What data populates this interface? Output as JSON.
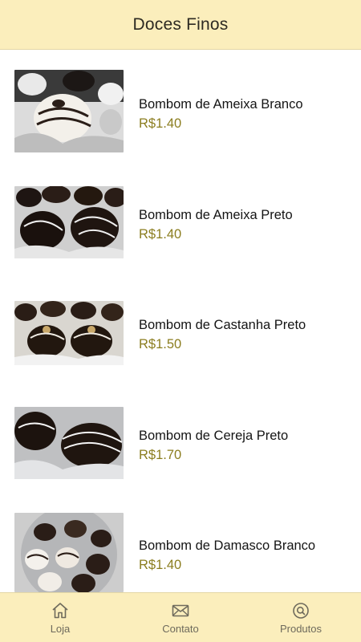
{
  "header": {
    "title": "Doces Finos"
  },
  "products": [
    {
      "name": "Bombom de Ameixa Branco",
      "price": "R$1.40",
      "image": "white-chocolate-bonbons-photo"
    },
    {
      "name": "Bombom de Ameixa Preto",
      "price": "R$1.40",
      "image": "dark-chocolate-bonbons-photo"
    },
    {
      "name": "Bombom de Castanha Preto",
      "price": "R$1.50",
      "image": "chestnut-dark-bonbons-photo"
    },
    {
      "name": "Bombom de Cereja Preto",
      "price": "R$1.70",
      "image": "cherry-dark-bonbons-photo"
    },
    {
      "name": "Bombom de Damasco Branco",
      "price": "R$1.40",
      "image": "apricot-white-bonbons-photo"
    }
  ],
  "tabs": [
    {
      "label": "Loja",
      "icon": "home-icon"
    },
    {
      "label": "Contato",
      "icon": "mail-icon"
    },
    {
      "label": "Produtos",
      "icon": "search-icon"
    }
  ],
  "colors": {
    "bar_background": "#fbeebc",
    "price": "#8b7d1f"
  }
}
